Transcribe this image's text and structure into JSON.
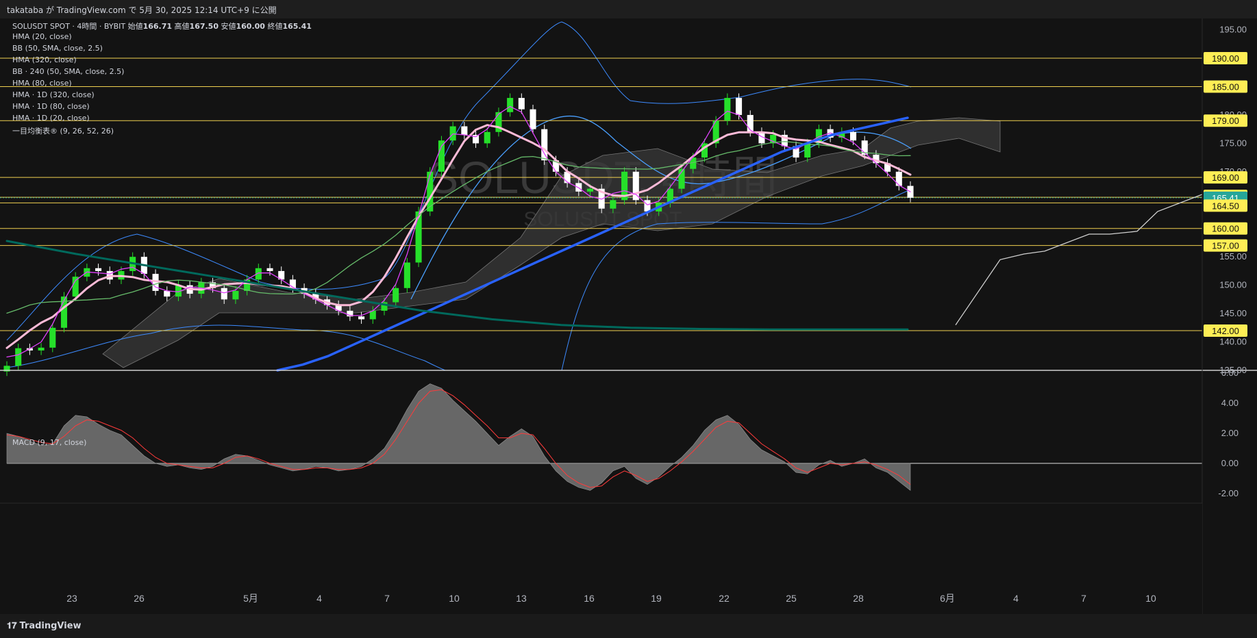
{
  "header": {
    "text": "takataba が TradingView.com で 5月 30, 2025 12:14 UTC+9 に公開"
  },
  "watermark": {
    "line1": "SOLUSDT, 4時間",
    "line2": "SOLUSDT SPOT"
  },
  "legend": {
    "symbol_line": "SOLUSDT SPOT · 4時間 · BYBIT",
    "ohlc": {
      "open_label": "始値",
      "open": "166.71",
      "high_label": "高値",
      "high": "167.50",
      "low_label": "安値",
      "low": "160.00",
      "close_label": "終値",
      "close": "165.41"
    },
    "indicators": [
      "HMA (20, close)",
      "BB (50, SMA, close, 2.5)",
      "HMA (320, close)",
      "BB · 240 (50, SMA, close, 2.5)",
      "HMA (80, close)",
      "HMA · 1D (320, close)",
      "HMA · 1D (80, close)",
      "HMA · 1D (20, close)",
      "一目均衡表® (9, 26, 52, 26)"
    ],
    "macd": "MACD (9, 17, close)"
  },
  "footer": {
    "logo": "TradingView"
  },
  "colors": {
    "bg": "#131313",
    "candle_up": "#26e02a",
    "candle_down": "#ffffff",
    "hma20": "#e040fb",
    "hma80": "#ffbbd8",
    "hma320": "#2962ff",
    "bb": "#3d8bff",
    "hma1d80": "#66bb6a",
    "hma1d320": "#00695c",
    "level_line": "#f0d050",
    "level_badge": "#ffee55",
    "price_badge": "#26a69a",
    "macd_hist": "#777777",
    "macd_signal": "#ff3b3b"
  },
  "chart_data": [
    {
      "type": "line",
      "title": "SOLUSDT SPOT · 4時間 · BYBIT",
      "x_tick_labels": [
        "23",
        "26",
        "5月",
        "4",
        "7",
        "10",
        "13",
        "16",
        "19",
        "22",
        "25",
        "28",
        "6月",
        "4",
        "7",
        "10"
      ],
      "y_tick_labels": [
        "195.00",
        "190.00",
        "185.00",
        "180.00",
        "175.00",
        "170.00",
        "165.00",
        "160.00",
        "155.00",
        "150.00",
        "145.00",
        "140.00",
        "135.00"
      ],
      "ylim": [
        135,
        197
      ],
      "horizontal_levels": [
        190,
        185,
        179,
        169,
        165.5,
        164.5,
        160,
        157,
        142
      ],
      "last_price": 165.41,
      "level_badges": [
        "190.00",
        "185.00",
        "179.00",
        "169.00",
        "165.50",
        "165.41",
        "164.50",
        "160.00",
        "157.00",
        "142.00"
      ],
      "series": [
        {
          "name": "close",
          "values": [
            135.8,
            138.9,
            138.5,
            139.0,
            142.5,
            148.0,
            151.5,
            153.0,
            152.5,
            151.0,
            152.5,
            155.0,
            152.0,
            149.0,
            148.0,
            150.0,
            148.5,
            150.5,
            149.5,
            147.5,
            149.0,
            151.0,
            153.0,
            152.5,
            151.0,
            149.5,
            148.5,
            147.5,
            146.5,
            145.5,
            144.5,
            144.0,
            145.5,
            147.0,
            149.5,
            154.0,
            163.0,
            170.0,
            175.5,
            178.0,
            176.5,
            175.0,
            177.0,
            180.5,
            183.0,
            181.0,
            177.5,
            172.0,
            170.0,
            168.0,
            166.5,
            167.0,
            163.5,
            165.0,
            170.0,
            165.0,
            163.0,
            164.5,
            167.0,
            170.5,
            172.5,
            175.0,
            179.0,
            183.0,
            180.0,
            177.0,
            175.0,
            176.5,
            174.5,
            172.5,
            175.0,
            177.5,
            176.0,
            177.0,
            175.5,
            173.0,
            171.5,
            170.0,
            167.5,
            165.41
          ]
        },
        {
          "name": "HMA (320, close)",
          "values": [
            135.0,
            136.0,
            137.5,
            139.5,
            141.5,
            143.5,
            145.5,
            147.5,
            149.5,
            151.5,
            153.5,
            155.5,
            157.5,
            159.5,
            161.5,
            163.5,
            165.5,
            167.5,
            169.5,
            171.5,
            173.5,
            175.0,
            176.5,
            177.5,
            178.5,
            179.5
          ]
        },
        {
          "name": "HMA · 1D (320, close)",
          "values": [
            157.8,
            155.5,
            153.5,
            151.5,
            149.5,
            147.5,
            145.5,
            144.0,
            143.0,
            142.5,
            142.3,
            142.2,
            142.2,
            142.2
          ]
        },
        {
          "name": "projection",
          "values": [
            143.0,
            154.5,
            155.5,
            156.0,
            159.0,
            159.0,
            159.5,
            163.0,
            166.0
          ]
        }
      ]
    },
    {
      "type": "area",
      "title": "MACD (9, 17, close)",
      "ylim": [
        -2.6,
        6.1
      ],
      "y_tick_labels": [
        "6.00",
        "4.00",
        "2.00",
        "0.00",
        "-2.00"
      ],
      "series": [
        {
          "name": "MACD",
          "values": [
            2.0,
            1.8,
            1.5,
            1.2,
            1.3,
            2.5,
            3.2,
            3.1,
            2.6,
            2.2,
            1.9,
            1.2,
            0.5,
            0.0,
            -0.2,
            -0.1,
            -0.3,
            -0.4,
            -0.2,
            0.3,
            0.6,
            0.5,
            0.2,
            -0.1,
            -0.3,
            -0.5,
            -0.4,
            -0.2,
            -0.3,
            -0.5,
            -0.4,
            -0.2,
            0.3,
            1.0,
            2.2,
            3.6,
            4.8,
            5.3,
            5.0,
            4.2,
            3.5,
            2.8,
            2.0,
            1.2,
            1.8,
            2.3,
            1.8,
            0.5,
            -0.5,
            -1.2,
            -1.6,
            -1.8,
            -1.3,
            -0.5,
            -0.2,
            -1.0,
            -1.4,
            -0.9,
            -0.2,
            0.4,
            1.2,
            2.2,
            2.9,
            3.2,
            2.6,
            1.6,
            0.9,
            0.5,
            0.1,
            -0.6,
            -0.7,
            -0.1,
            0.2,
            -0.2,
            0.0,
            0.3,
            -0.3,
            -0.6,
            -1.2,
            -1.8
          ]
        },
        {
          "name": "Signal",
          "values": [
            1.9,
            1.8,
            1.6,
            1.4,
            1.3,
            1.8,
            2.5,
            2.9,
            2.8,
            2.5,
            2.2,
            1.7,
            1.0,
            0.4,
            0.0,
            -0.1,
            -0.2,
            -0.3,
            -0.3,
            0.0,
            0.4,
            0.5,
            0.3,
            0.0,
            -0.2,
            -0.4,
            -0.4,
            -0.3,
            -0.3,
            -0.4,
            -0.4,
            -0.3,
            0.0,
            0.6,
            1.6,
            2.8,
            4.0,
            4.8,
            4.9,
            4.5,
            3.9,
            3.2,
            2.5,
            1.7,
            1.7,
            2.0,
            1.9,
            1.0,
            0.0,
            -0.8,
            -1.3,
            -1.6,
            -1.5,
            -0.9,
            -0.5,
            -0.8,
            -1.2,
            -1.0,
            -0.5,
            0.1,
            0.8,
            1.6,
            2.4,
            2.8,
            2.7,
            2.0,
            1.3,
            0.8,
            0.3,
            -0.3,
            -0.6,
            -0.3,
            0.0,
            -0.1,
            0.0,
            0.1,
            -0.1,
            -0.4,
            -0.8,
            -1.4
          ]
        }
      ]
    }
  ]
}
